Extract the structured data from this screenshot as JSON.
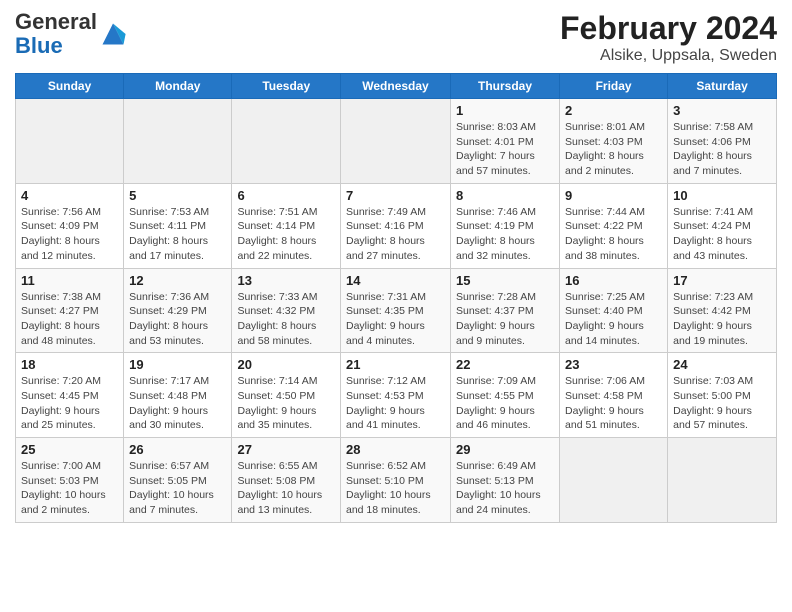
{
  "header": {
    "logo_general": "General",
    "logo_blue": "Blue",
    "title": "February 2024",
    "subtitle": "Alsike, Uppsala, Sweden"
  },
  "days_of_week": [
    "Sunday",
    "Monday",
    "Tuesday",
    "Wednesday",
    "Thursday",
    "Friday",
    "Saturday"
  ],
  "weeks": [
    [
      {
        "day": "",
        "info": ""
      },
      {
        "day": "",
        "info": ""
      },
      {
        "day": "",
        "info": ""
      },
      {
        "day": "",
        "info": ""
      },
      {
        "day": "1",
        "info": "Sunrise: 8:03 AM\nSunset: 4:01 PM\nDaylight: 7 hours\nand 57 minutes."
      },
      {
        "day": "2",
        "info": "Sunrise: 8:01 AM\nSunset: 4:03 PM\nDaylight: 8 hours\nand 2 minutes."
      },
      {
        "day": "3",
        "info": "Sunrise: 7:58 AM\nSunset: 4:06 PM\nDaylight: 8 hours\nand 7 minutes."
      }
    ],
    [
      {
        "day": "4",
        "info": "Sunrise: 7:56 AM\nSunset: 4:09 PM\nDaylight: 8 hours\nand 12 minutes."
      },
      {
        "day": "5",
        "info": "Sunrise: 7:53 AM\nSunset: 4:11 PM\nDaylight: 8 hours\nand 17 minutes."
      },
      {
        "day": "6",
        "info": "Sunrise: 7:51 AM\nSunset: 4:14 PM\nDaylight: 8 hours\nand 22 minutes."
      },
      {
        "day": "7",
        "info": "Sunrise: 7:49 AM\nSunset: 4:16 PM\nDaylight: 8 hours\nand 27 minutes."
      },
      {
        "day": "8",
        "info": "Sunrise: 7:46 AM\nSunset: 4:19 PM\nDaylight: 8 hours\nand 32 minutes."
      },
      {
        "day": "9",
        "info": "Sunrise: 7:44 AM\nSunset: 4:22 PM\nDaylight: 8 hours\nand 38 minutes."
      },
      {
        "day": "10",
        "info": "Sunrise: 7:41 AM\nSunset: 4:24 PM\nDaylight: 8 hours\nand 43 minutes."
      }
    ],
    [
      {
        "day": "11",
        "info": "Sunrise: 7:38 AM\nSunset: 4:27 PM\nDaylight: 8 hours\nand 48 minutes."
      },
      {
        "day": "12",
        "info": "Sunrise: 7:36 AM\nSunset: 4:29 PM\nDaylight: 8 hours\nand 53 minutes."
      },
      {
        "day": "13",
        "info": "Sunrise: 7:33 AM\nSunset: 4:32 PM\nDaylight: 8 hours\nand 58 minutes."
      },
      {
        "day": "14",
        "info": "Sunrise: 7:31 AM\nSunset: 4:35 PM\nDaylight: 9 hours\nand 4 minutes."
      },
      {
        "day": "15",
        "info": "Sunrise: 7:28 AM\nSunset: 4:37 PM\nDaylight: 9 hours\nand 9 minutes."
      },
      {
        "day": "16",
        "info": "Sunrise: 7:25 AM\nSunset: 4:40 PM\nDaylight: 9 hours\nand 14 minutes."
      },
      {
        "day": "17",
        "info": "Sunrise: 7:23 AM\nSunset: 4:42 PM\nDaylight: 9 hours\nand 19 minutes."
      }
    ],
    [
      {
        "day": "18",
        "info": "Sunrise: 7:20 AM\nSunset: 4:45 PM\nDaylight: 9 hours\nand 25 minutes."
      },
      {
        "day": "19",
        "info": "Sunrise: 7:17 AM\nSunset: 4:48 PM\nDaylight: 9 hours\nand 30 minutes."
      },
      {
        "day": "20",
        "info": "Sunrise: 7:14 AM\nSunset: 4:50 PM\nDaylight: 9 hours\nand 35 minutes."
      },
      {
        "day": "21",
        "info": "Sunrise: 7:12 AM\nSunset: 4:53 PM\nDaylight: 9 hours\nand 41 minutes."
      },
      {
        "day": "22",
        "info": "Sunrise: 7:09 AM\nSunset: 4:55 PM\nDaylight: 9 hours\nand 46 minutes."
      },
      {
        "day": "23",
        "info": "Sunrise: 7:06 AM\nSunset: 4:58 PM\nDaylight: 9 hours\nand 51 minutes."
      },
      {
        "day": "24",
        "info": "Sunrise: 7:03 AM\nSunset: 5:00 PM\nDaylight: 9 hours\nand 57 minutes."
      }
    ],
    [
      {
        "day": "25",
        "info": "Sunrise: 7:00 AM\nSunset: 5:03 PM\nDaylight: 10 hours\nand 2 minutes."
      },
      {
        "day": "26",
        "info": "Sunrise: 6:57 AM\nSunset: 5:05 PM\nDaylight: 10 hours\nand 7 minutes."
      },
      {
        "day": "27",
        "info": "Sunrise: 6:55 AM\nSunset: 5:08 PM\nDaylight: 10 hours\nand 13 minutes."
      },
      {
        "day": "28",
        "info": "Sunrise: 6:52 AM\nSunset: 5:10 PM\nDaylight: 10 hours\nand 18 minutes."
      },
      {
        "day": "29",
        "info": "Sunrise: 6:49 AM\nSunset: 5:13 PM\nDaylight: 10 hours\nand 24 minutes."
      },
      {
        "day": "",
        "info": ""
      },
      {
        "day": "",
        "info": ""
      }
    ]
  ]
}
